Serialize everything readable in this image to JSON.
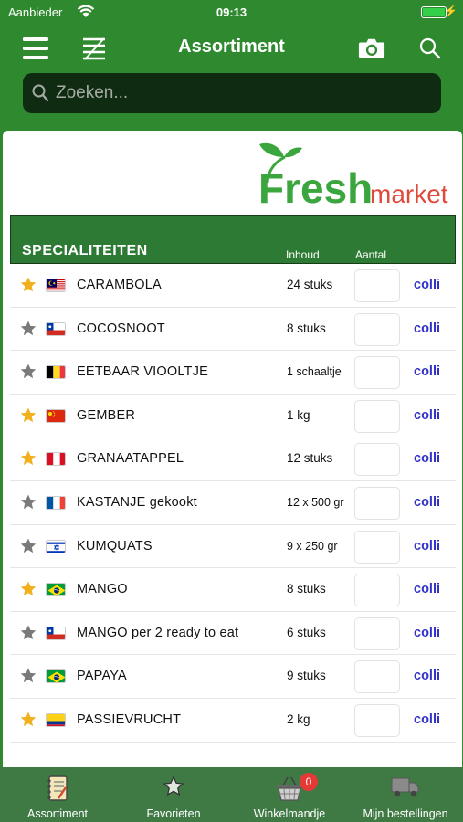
{
  "status": {
    "carrier": "Aanbieder",
    "time": "09:13"
  },
  "nav": {
    "title": "Assortiment",
    "icons": [
      "menu-icon",
      "list-icon",
      "camera-icon",
      "search-icon"
    ]
  },
  "search": {
    "placeholder": "Zoeken..."
  },
  "logo": {
    "text_fresh": "Fresh",
    "text_market": "market"
  },
  "section": {
    "title": "SPECIALITEITEN",
    "col_inhoud": "Inhoud",
    "col_aantal": "Aantal"
  },
  "colors": {
    "green": "#2f8a2f",
    "header_green": "#2d7a34",
    "tabbar": "#3f7a45",
    "link_blue": "#3232c8",
    "star_gold": "#f2b01e",
    "star_grey": "#7a7a7a"
  },
  "products": [
    {
      "favorite": true,
      "flag": "malaysia",
      "name": "CARAMBOLA",
      "content": "24 stuks",
      "unit": "colli"
    },
    {
      "favorite": false,
      "flag": "chile",
      "name": "COCOSNOOT",
      "content": "8 stuks",
      "unit": "colli"
    },
    {
      "favorite": false,
      "flag": "belgium",
      "name": "EETBAAR VIOOLTJE",
      "content": "1 schaaltje",
      "unit": "colli"
    },
    {
      "favorite": true,
      "flag": "china",
      "name": "GEMBER",
      "content": "1 kg",
      "unit": "colli"
    },
    {
      "favorite": true,
      "flag": "peru",
      "name": "GRANAATAPPEL",
      "content": "12 stuks",
      "unit": "colli"
    },
    {
      "favorite": false,
      "flag": "france",
      "name": "KASTANJE gekookt",
      "content": "12 x 500 gr",
      "unit": "colli"
    },
    {
      "favorite": false,
      "flag": "israel",
      "name": "KUMQUATS",
      "content": "9 x 250 gr",
      "unit": "colli"
    },
    {
      "favorite": true,
      "flag": "brazil",
      "name": "MANGO",
      "content": "8 stuks",
      "unit": "colli"
    },
    {
      "favorite": false,
      "flag": "chile",
      "name": "MANGO per 2 ready to eat",
      "content": "6 stuks",
      "unit": "colli"
    },
    {
      "favorite": false,
      "flag": "brazil",
      "name": "PAPAYA",
      "content": "9 stuks",
      "unit": "colli"
    },
    {
      "favorite": true,
      "flag": "colombia",
      "name": "PASSIEVRUCHT",
      "content": "2 kg",
      "unit": "colli"
    }
  ],
  "tabs": [
    {
      "label": "Assortiment",
      "icon": "notebook-icon"
    },
    {
      "label": "Favorieten",
      "icon": "star-outline-icon"
    },
    {
      "label": "Winkelmandje",
      "icon": "basket-icon",
      "badge": "0"
    },
    {
      "label": "Mijn bestellingen",
      "icon": "truck-icon"
    }
  ]
}
